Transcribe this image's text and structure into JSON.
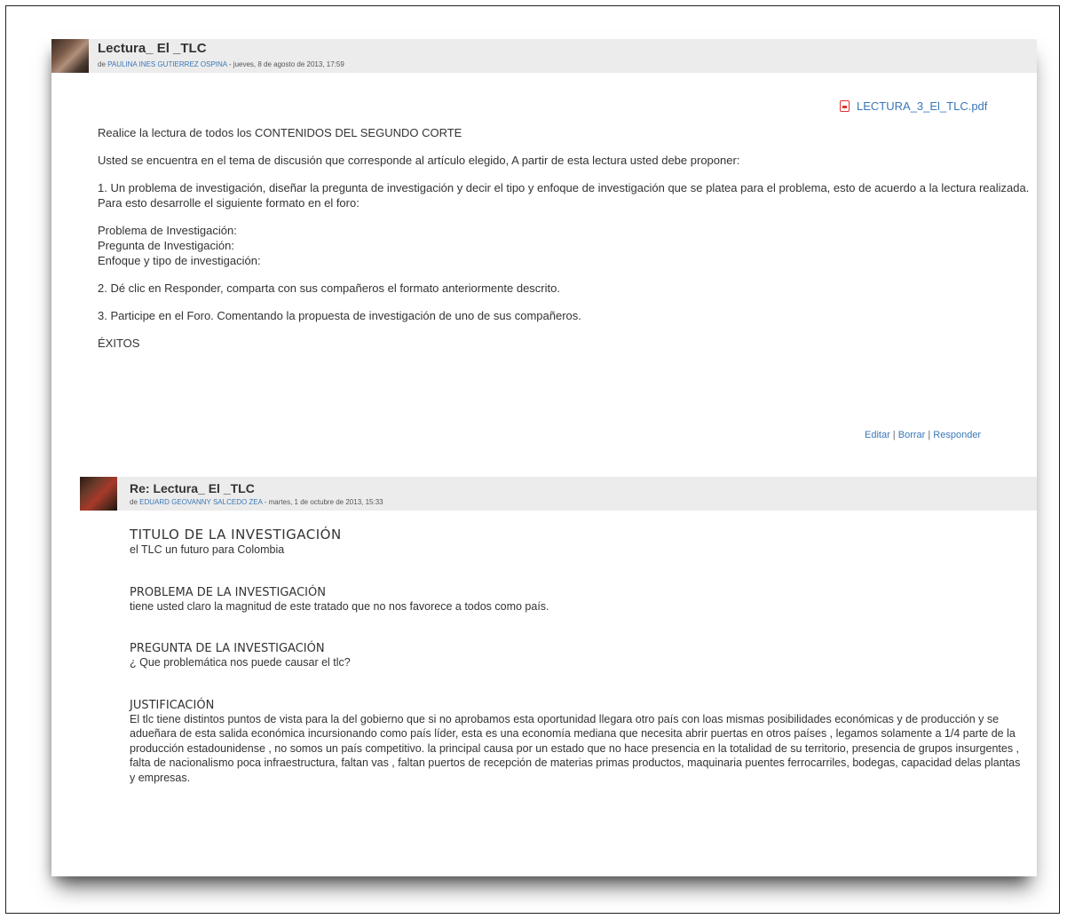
{
  "post": {
    "subject": "Lectura_ El _TLC",
    "by_prefix": "de ",
    "author": "PAULINA INES GUTIERREZ OSPINA",
    "date": " - jueves, 8 de agosto de 2013, 17:59",
    "attachment": "LECTURA_3_El_TLC.pdf",
    "paragraphs": [
      "Realice la lectura de todos los CONTENIDOS DEL SEGUNDO CORTE",
      "Usted se encuentra en el tema de discusión que corresponde al artículo elegido, A partir de esta lectura usted debe proponer:",
      "1. Un problema de investigación, diseñar la pregunta de investigación y decir el tipo y enfoque de investigación que se platea para el problema, esto de acuerdo a la lectura realizada. Para esto desarrolle el siguiente formato en el foro:"
    ],
    "format_lines": [
      "Problema de Investigación:",
      "Pregunta de Investigación:",
      "Enfoque y tipo de investigación:"
    ],
    "step2": "2. Dé clic en Responder, comparta con sus compañeros el formato anteriormente descrito.",
    "step3": "3. Participe en el Foro. Comentando la propuesta de investigación de uno de sus compañeros.",
    "closing": "ÉXITOS",
    "commands": {
      "edit": "Editar",
      "sep": " | ",
      "delete": "Borrar",
      "reply": "Responder"
    }
  },
  "reply": {
    "subject": "Re: Lectura_ El _TLC",
    "by_prefix": "de ",
    "author": "EDUARD GEOVANNY SALCEDO ZEA",
    "date": " - martes, 1 de octubre de 2013, 15:33",
    "title_heading": "TITULO DE LA INVESTIGACIÓN",
    "title_text": "el TLC un futuro para Colombia",
    "problem_heading": "PROBLEMA DE LA INVESTIGACIÓN",
    "problem_text": "tiene usted claro la magnitud de este tratado que no nos favorece a todos como país.",
    "question_heading": "PREGUNTA DE LA INVESTIGACIÓN",
    "question_text": "¿ Que problemática nos puede causar el tlc?",
    "justification_heading": "JUSTIFICACIÓN",
    "justification_text": "El tlc tiene distintos puntos de vista para la del gobierno que si no aprobamos esta oportunidad llegara otro país con loas mismas posibilidades económicas y de producción y se adueñara de esta salida económica incursionando como país líder, esta es una economía mediana que necesita abrir puertas en otros países , legamos solamente a 1/4 parte de la producción estadounidense , no somos un país competitivo. la principal causa por un estado que no hace presencia en la totalidad de su territorio, presencia de grupos insurgentes , falta de nacionalismo poca infraestructura, faltan vas , faltan puertos de recepción de materias primas productos, maquinaria puentes ferrocarriles, bodegas, capacidad delas plantas y empresas."
  }
}
